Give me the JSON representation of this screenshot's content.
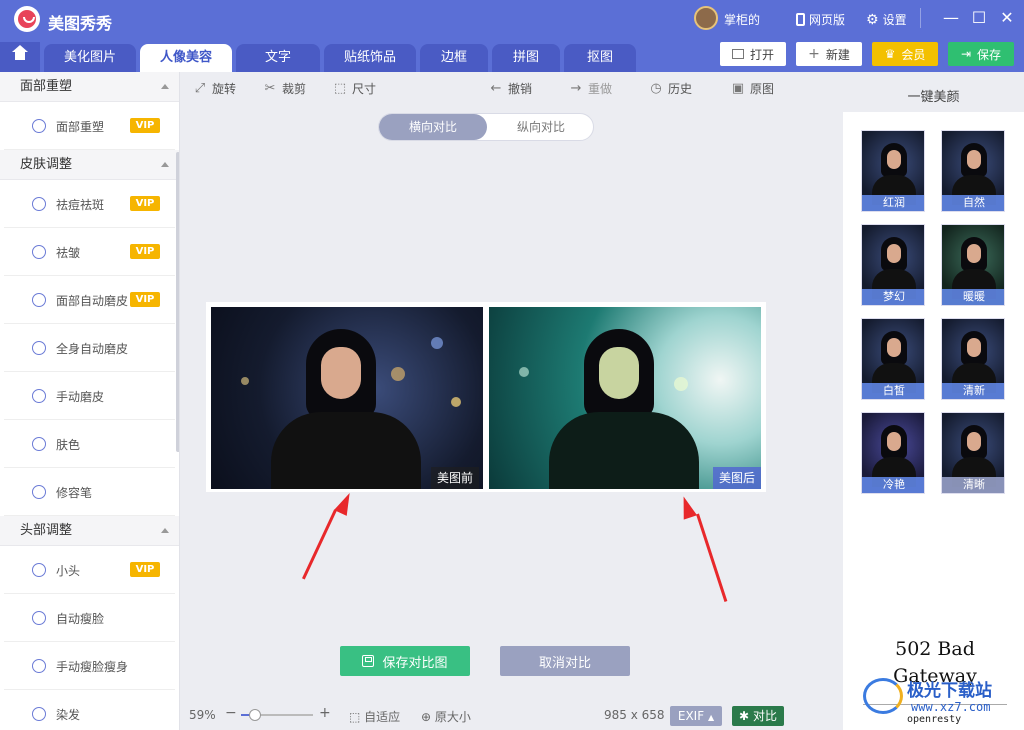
{
  "app": {
    "title": "美图秀秀",
    "user_name": "掌柜的",
    "web_version": "网页版",
    "settings": "设置",
    "minimize": "—",
    "maximize": "☐",
    "close": "✕"
  },
  "tabs": [
    {
      "label": "美化图片"
    },
    {
      "label": "人像美容",
      "active": true
    },
    {
      "label": "文字"
    },
    {
      "label": "贴纸饰品"
    },
    {
      "label": "边框"
    },
    {
      "label": "拼图"
    },
    {
      "label": "抠图"
    }
  ],
  "header_buttons": {
    "open": "打开",
    "new": "新建",
    "member": "会员",
    "save": "保存"
  },
  "sidebar": {
    "sections": [
      {
        "title": "面部重塑",
        "items": [
          {
            "label": "面部重塑",
            "vip": true
          }
        ]
      },
      {
        "title": "皮肤调整",
        "items": [
          {
            "label": "祛痘祛斑",
            "vip": true
          },
          {
            "label": "祛皱",
            "vip": true
          },
          {
            "label": "面部自动磨皮",
            "vip": true
          },
          {
            "label": "全身自动磨皮",
            "vip": false
          },
          {
            "label": "手动磨皮",
            "vip": false
          },
          {
            "label": "肤色",
            "vip": false
          },
          {
            "label": "修容笔",
            "vip": false
          }
        ]
      },
      {
        "title": "头部调整",
        "items": [
          {
            "label": "小头",
            "vip": true
          },
          {
            "label": "自动瘦脸",
            "vip": false
          },
          {
            "label": "手动瘦脸瘦身",
            "vip": false
          },
          {
            "label": "染发",
            "vip": false
          }
        ]
      }
    ],
    "vip_label": "VIP"
  },
  "toolbar": {
    "rotate": "旋转",
    "crop": "裁剪",
    "size": "尺寸",
    "undo": "撤销",
    "redo": "重做",
    "history": "历史",
    "original": "原图"
  },
  "compare_toggle": {
    "horizontal": "横向对比",
    "vertical": "纵向对比"
  },
  "photos": {
    "before_label": "美图前",
    "after_label": "美图后"
  },
  "buttons": {
    "save_compare": "保存对比图",
    "cancel_compare": "取消对比"
  },
  "status": {
    "zoom": "59%",
    "zoom_level": 0.59,
    "fit": "自适应",
    "original_size": "原大小",
    "dimensions": "985 x 658",
    "exif": "EXIF",
    "compare": "对比"
  },
  "right_panel": {
    "title": "一键美颜",
    "presets": [
      "红润",
      "自然",
      "梦幻",
      "暖暖",
      "白皙",
      "清新",
      "冷艳",
      "清晰"
    ],
    "error_title": "502 Bad Gateway",
    "error_server": "openresty",
    "watermark": "极光下载站",
    "watermark_url": "www.xz7.com"
  },
  "colors": {
    "brand": "#5b6fd6",
    "save_green": "#2fbf71",
    "vip_gold": "#f6b500",
    "arrow_red": "#e8282b"
  }
}
